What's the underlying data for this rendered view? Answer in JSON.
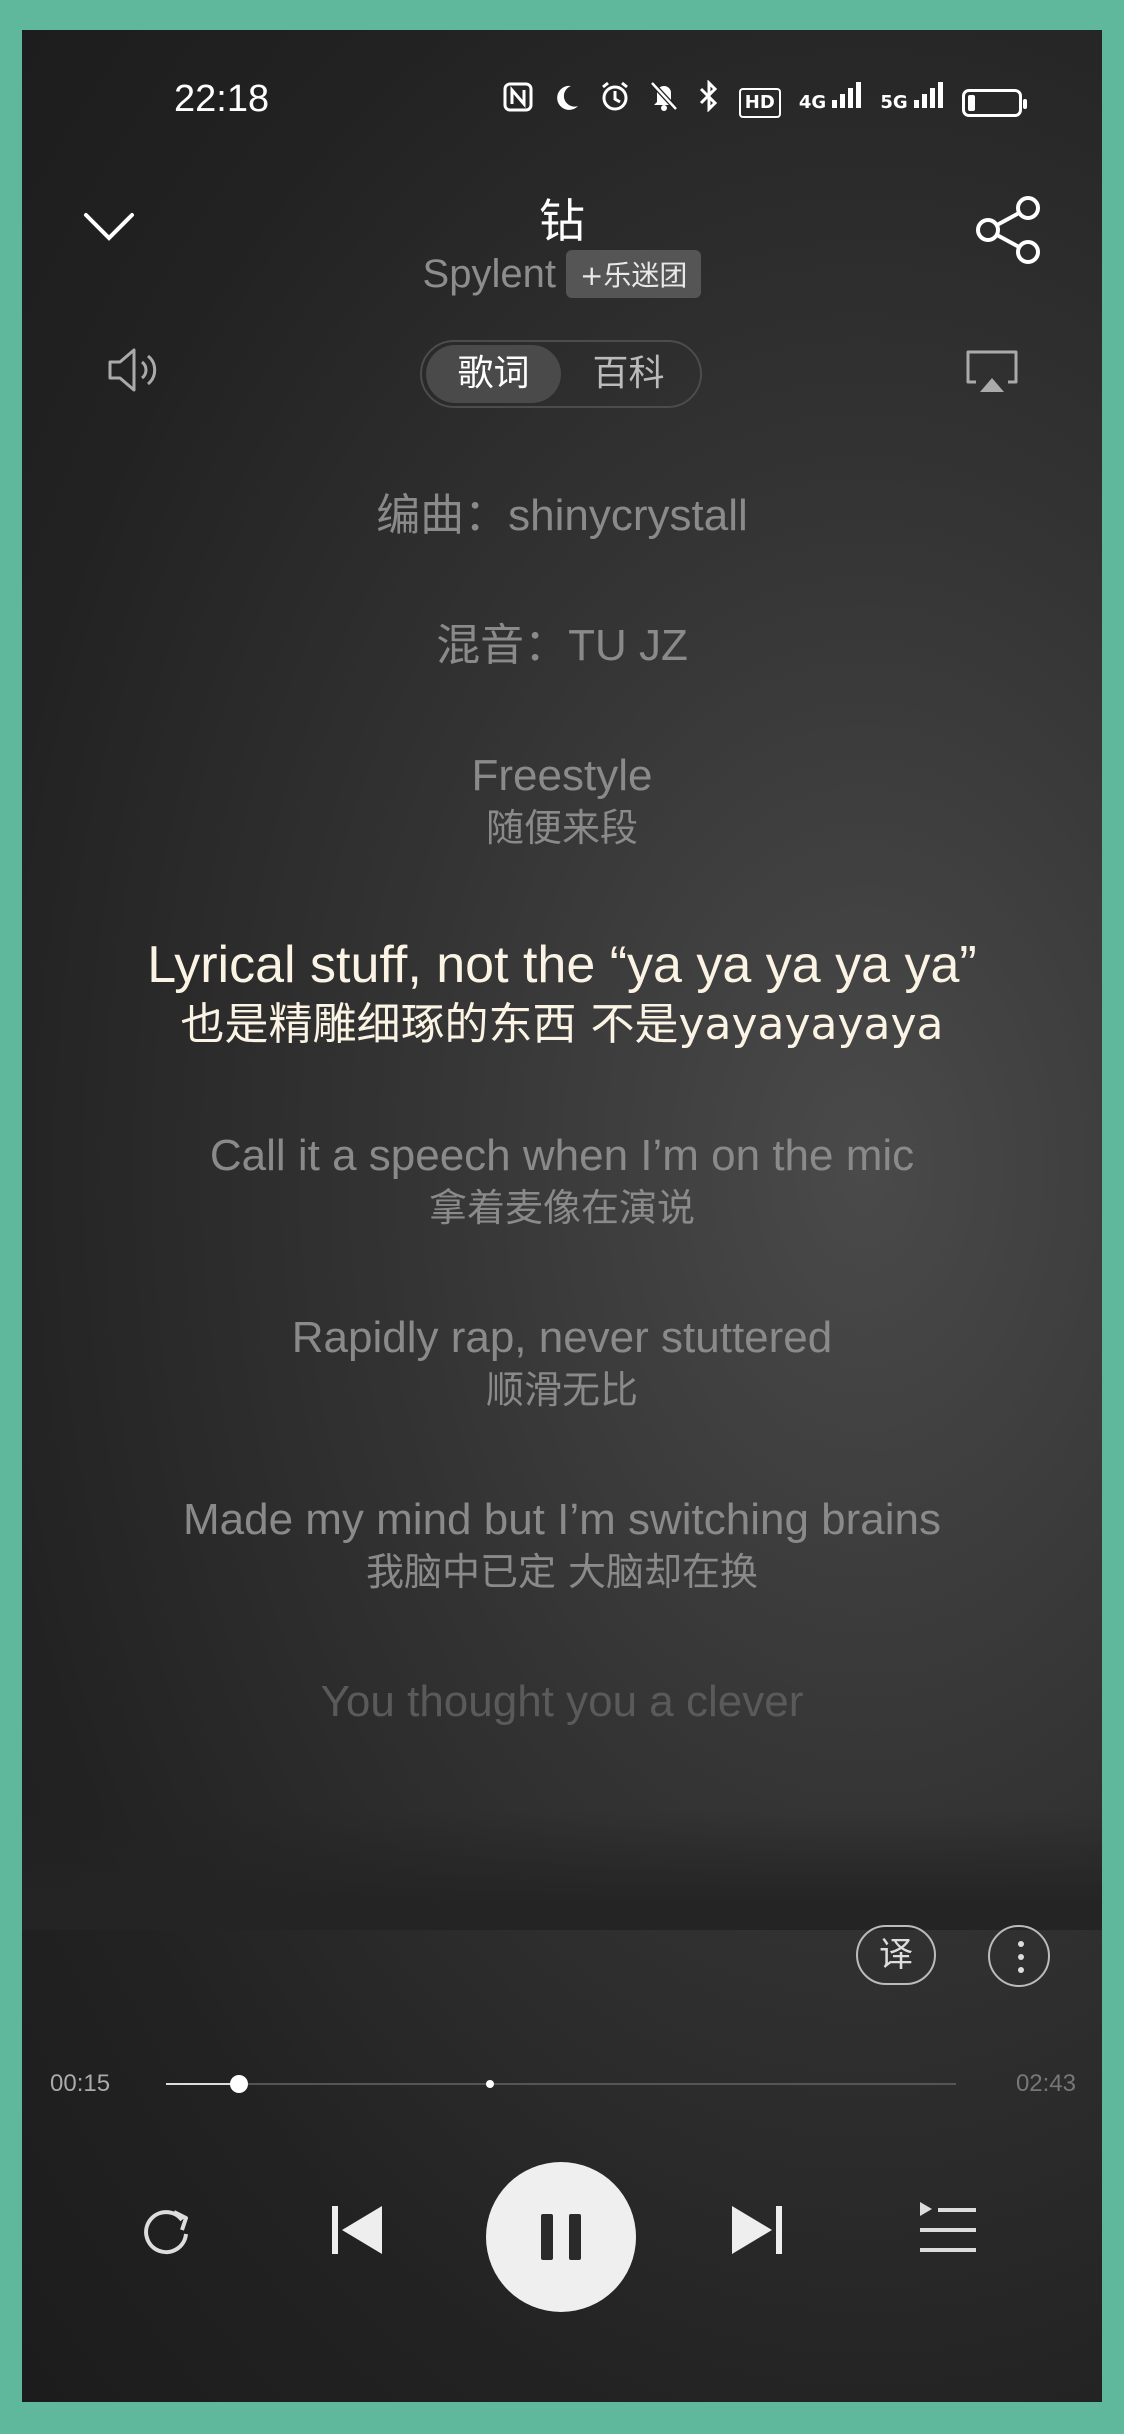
{
  "status_bar": {
    "time": "22:18",
    "icons": [
      "nfc-icon",
      "moon-icon",
      "alarm-icon",
      "mute-icon",
      "bluetooth-icon",
      "hd-icon",
      "4g-signal-icon",
      "5g-signal-icon",
      "battery-icon"
    ],
    "hd_label": "HD",
    "sig1_label": "4G",
    "sig2_label": "5G",
    "battery_level": 0.15
  },
  "header": {
    "title": "钻",
    "artist": "Spylent",
    "fan_button": "+乐迷团"
  },
  "tabs": [
    {
      "label": "歌词",
      "active": true
    },
    {
      "label": "百科",
      "active": false
    }
  ],
  "lyrics": [
    {
      "en": "编曲：shinycrystall",
      "zh": ""
    },
    {
      "en": "混音：TU JZ",
      "zh": ""
    },
    {
      "en": "Freestyle",
      "zh": "随便来段"
    },
    {
      "en": "Lyrical stuff, not the “ya ya ya ya ya”",
      "zh": "也是精雕细琢的东西 不是yayayayaya"
    },
    {
      "en": "Call it a speech when I’m on the mic",
      "zh": "拿着麦像在演说"
    },
    {
      "en": "Rapidly rap, never stuttered",
      "zh": "顺滑无比"
    },
    {
      "en": "Made my mind but I’m switching brains",
      "zh": "我脑中已定 大脑却在换"
    },
    {
      "en": "You thought you a clever",
      "zh": ""
    }
  ],
  "buttons": {
    "translate": "译"
  },
  "player": {
    "current_time": "00:15",
    "total_time": "02:43",
    "progress": 0.092,
    "marker": 0.41
  },
  "colors": {
    "highlight": "#fbf3e4",
    "frame": "#5fb89c"
  }
}
